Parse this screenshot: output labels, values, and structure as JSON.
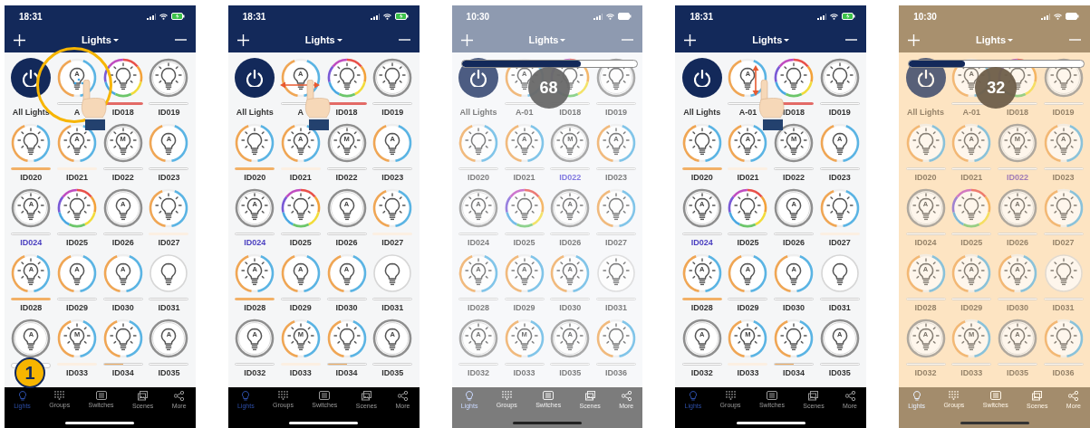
{
  "phones": [
    {
      "kind": "normal",
      "status": {
        "time": "18:31",
        "battery_charging": true
      },
      "header": {
        "title": "Lights"
      },
      "gesture": {
        "kind": "tap",
        "highlight": true,
        "step": "1"
      },
      "tiles": [
        {
          "kind": "power",
          "label": "All Lights",
          "selected": false
        },
        {
          "kind": "warm",
          "label": "A",
          "letter": "A",
          "rays": false,
          "selected": false
        },
        {
          "kind": "rainbow",
          "label": "ID018",
          "rays": true,
          "color": "#e36a66",
          "selected": false
        },
        {
          "kind": "grey",
          "label": "ID019",
          "rays": true,
          "selected": false
        },
        {
          "kind": "warm",
          "label": "ID020",
          "rays": true,
          "color": "#f2b066",
          "selected": false
        },
        {
          "kind": "warm",
          "label": "ID021",
          "letter": "A",
          "rays": true,
          "color": "#fcefe2",
          "selected": false
        },
        {
          "kind": "grey",
          "label": "ID022",
          "letter": "M",
          "rays": true,
          "selected": false
        },
        {
          "kind": "warm",
          "label": "ID023",
          "letter": "A",
          "rays": false,
          "selected": false
        },
        {
          "kind": "grey",
          "label": "ID024",
          "letter": "A",
          "rays": true,
          "selected": true
        },
        {
          "kind": "rainbow",
          "label": "ID025",
          "rays": true,
          "selected": false
        },
        {
          "kind": "grey",
          "label": "ID026",
          "letter": "A",
          "rays": false,
          "selected": false
        },
        {
          "kind": "warm",
          "label": "ID027",
          "rays": true,
          "color": "#fcefe2",
          "selected": false
        },
        {
          "kind": "warm",
          "label": "ID028",
          "letter": "A",
          "rays": true,
          "color": "#f2b066",
          "selected": false
        },
        {
          "kind": "warm",
          "label": "ID029",
          "letter": "A",
          "rays": false,
          "selected": false
        },
        {
          "kind": "warm",
          "label": "ID030",
          "letter": "A",
          "rays": false,
          "selected": false
        },
        {
          "kind": "faint",
          "label": "ID031",
          "rays": false,
          "selected": false
        },
        {
          "kind": "grey",
          "letter": "A",
          "rays": false
        },
        {
          "kind": "warm",
          "label": "ID033",
          "letter": "M",
          "rays": true,
          "color": "#fcefe2",
          "selected": false
        },
        {
          "kind": "warm",
          "label": "ID034",
          "rays": true,
          "color": "#f2b066",
          "level": 0.5,
          "selected": false
        },
        {
          "kind": "grey",
          "label": "ID035",
          "letter": "A",
          "rays": false,
          "selected": false
        }
      ],
      "tabs": [
        {
          "label": "Lights",
          "selected": true
        },
        {
          "label": "Groups",
          "selected": false
        },
        {
          "label": "Switches",
          "selected": false
        },
        {
          "label": "Scenes",
          "selected": false
        },
        {
          "label": "More",
          "selected": false
        }
      ]
    },
    {
      "kind": "normal",
      "status": {
        "time": "18:31",
        "battery_charging": true
      },
      "header": {
        "title": "Lights"
      },
      "gesture": {
        "kind": "swipe-horizontal"
      },
      "tiles": [
        {
          "kind": "power",
          "label": "All Lights",
          "selected": false
        },
        {
          "kind": "warm",
          "label": "A",
          "letter": "A",
          "rays": false,
          "selected": false
        },
        {
          "kind": "rainbow",
          "label": "ID018",
          "rays": true,
          "color": "#e36a66",
          "selected": false
        },
        {
          "kind": "grey",
          "label": "ID019",
          "rays": true,
          "selected": false
        },
        {
          "kind": "warm",
          "label": "ID020",
          "rays": true,
          "color": "#f2b066",
          "selected": false
        },
        {
          "kind": "warm",
          "label": "ID021",
          "letter": "A",
          "rays": true,
          "color": "#fcefe2",
          "selected": false
        },
        {
          "kind": "grey",
          "label": "ID022",
          "letter": "M",
          "rays": true,
          "selected": false
        },
        {
          "kind": "warm",
          "label": "ID023",
          "letter": "A",
          "rays": false,
          "selected": false
        },
        {
          "kind": "grey",
          "label": "ID024",
          "letter": "A",
          "rays": true,
          "selected": true
        },
        {
          "kind": "rainbow",
          "label": "ID025",
          "rays": true,
          "selected": false
        },
        {
          "kind": "grey",
          "label": "ID026",
          "letter": "A",
          "rays": false,
          "selected": false
        },
        {
          "kind": "warm",
          "label": "ID027",
          "rays": true,
          "color": "#fcefe2",
          "selected": false
        },
        {
          "kind": "warm",
          "label": "ID028",
          "letter": "A",
          "rays": true,
          "color": "#f2b066",
          "selected": false
        },
        {
          "kind": "warm",
          "label": "ID029",
          "letter": "A",
          "rays": false,
          "selected": false
        },
        {
          "kind": "warm",
          "label": "ID030",
          "letter": "A",
          "rays": false,
          "selected": false
        },
        {
          "kind": "faint",
          "label": "ID031",
          "rays": false,
          "selected": false
        },
        {
          "kind": "grey",
          "label": "ID032",
          "letter": "A",
          "rays": false,
          "selected": false
        },
        {
          "kind": "warm",
          "label": "ID033",
          "letter": "M",
          "rays": true,
          "color": "#fcefe2",
          "selected": false
        },
        {
          "kind": "warm",
          "label": "ID034",
          "rays": true,
          "color": "#f2b066",
          "level": 0.5,
          "selected": false
        },
        {
          "kind": "grey",
          "label": "ID035",
          "letter": "A",
          "rays": false,
          "selected": false
        }
      ],
      "tabs": [
        {
          "label": "Lights",
          "selected": true
        },
        {
          "label": "Groups",
          "selected": false
        },
        {
          "label": "Switches",
          "selected": false
        },
        {
          "label": "Scenes",
          "selected": false
        },
        {
          "label": "More",
          "selected": false
        }
      ]
    },
    {
      "kind": "dimmed",
      "status": {
        "time": "10:30",
        "battery_charging": false
      },
      "header": {
        "title": "Lights"
      },
      "adjust": {
        "level": 0.68,
        "value": "68"
      },
      "tiles": [
        {
          "kind": "power",
          "label": "All Lights",
          "selected": false
        },
        {
          "kind": "warm",
          "label": "A-01",
          "letter": "A",
          "rays": true,
          "selected": false
        },
        {
          "kind": "rainbow",
          "label": "ID018",
          "rays": true,
          "selected": false
        },
        {
          "kind": "grey",
          "label": "ID019",
          "rays": true,
          "selected": false
        },
        {
          "kind": "warm",
          "label": "ID020",
          "rays": true,
          "selected": false
        },
        {
          "kind": "warm",
          "label": "ID021",
          "letter": "A",
          "rays": true,
          "selected": false
        },
        {
          "kind": "grey",
          "label": "ID022",
          "letter": "M",
          "rays": true,
          "selected": true
        },
        {
          "kind": "warm",
          "label": "ID023",
          "letter": "A",
          "rays": true,
          "selected": false
        },
        {
          "kind": "grey",
          "label": "ID024",
          "letter": "A",
          "rays": true,
          "selected": false
        },
        {
          "kind": "rainbow",
          "label": "ID025",
          "rays": true,
          "selected": false
        },
        {
          "kind": "grey",
          "label": "ID026",
          "letter": "A",
          "rays": true,
          "selected": false
        },
        {
          "kind": "warm",
          "label": "ID027",
          "rays": true,
          "selected": false
        },
        {
          "kind": "warm",
          "label": "ID028",
          "letter": "A",
          "rays": true,
          "selected": false
        },
        {
          "kind": "warm",
          "label": "ID029",
          "letter": "A",
          "rays": true,
          "selected": false
        },
        {
          "kind": "warm",
          "label": "ID030",
          "letter": "A",
          "rays": true,
          "selected": false
        },
        {
          "kind": "faint",
          "label": "ID031",
          "rays": true,
          "selected": false
        },
        {
          "kind": "grey",
          "label": "ID032",
          "letter": "A",
          "rays": true,
          "selected": false
        },
        {
          "kind": "warm",
          "label": "ID033",
          "letter": "M",
          "rays": true,
          "selected": false
        },
        {
          "kind": "grey",
          "label": "ID035",
          "letter": "A",
          "rays": true,
          "selected": false
        },
        {
          "kind": "warm",
          "label": "ID036",
          "rays": true,
          "selected": false
        }
      ],
      "tabs": [
        {
          "label": "Lights",
          "selected": true
        },
        {
          "label": "Groups",
          "selected": false
        },
        {
          "label": "Switches",
          "selected": false
        },
        {
          "label": "Scenes",
          "selected": false
        },
        {
          "label": "More",
          "selected": false
        }
      ]
    },
    {
      "kind": "normal",
      "status": {
        "time": "18:31",
        "battery_charging": true
      },
      "header": {
        "title": "Lights"
      },
      "gesture": {
        "kind": "swipe-vertical"
      },
      "tiles": [
        {
          "kind": "power",
          "label": "All Lights",
          "selected": false
        },
        {
          "kind": "warm",
          "label": "A-01",
          "letter": "A",
          "rays": false,
          "selected": false
        },
        {
          "kind": "rainbow",
          "label": "ID018",
          "rays": true,
          "color": "#e36a66",
          "selected": false
        },
        {
          "kind": "grey",
          "label": "ID019",
          "rays": true,
          "selected": false
        },
        {
          "kind": "warm",
          "label": "ID020",
          "rays": true,
          "color": "#f2b066",
          "selected": false
        },
        {
          "kind": "warm",
          "label": "ID021",
          "letter": "A",
          "rays": true,
          "color": "#fcefe2",
          "selected": false
        },
        {
          "kind": "grey",
          "label": "ID022",
          "letter": "M",
          "rays": true,
          "selected": false
        },
        {
          "kind": "warm",
          "label": "ID023",
          "letter": "A",
          "rays": false,
          "selected": false
        },
        {
          "kind": "grey",
          "label": "ID024",
          "letter": "A",
          "rays": true,
          "selected": true
        },
        {
          "kind": "rainbow",
          "label": "ID025",
          "rays": true,
          "selected": false
        },
        {
          "kind": "grey",
          "label": "ID026",
          "letter": "A",
          "rays": false,
          "selected": false
        },
        {
          "kind": "warm",
          "label": "ID027",
          "rays": true,
          "color": "#fcefe2",
          "selected": false
        },
        {
          "kind": "warm",
          "label": "ID028",
          "letter": "A",
          "rays": true,
          "color": "#f2b066",
          "selected": false
        },
        {
          "kind": "warm",
          "label": "ID029",
          "letter": "A",
          "rays": false,
          "selected": false
        },
        {
          "kind": "warm",
          "label": "ID030",
          "letter": "A",
          "rays": false,
          "selected": false
        },
        {
          "kind": "faint",
          "label": "ID031",
          "rays": false,
          "selected": false
        },
        {
          "kind": "grey",
          "label": "ID032",
          "letter": "A",
          "rays": false,
          "selected": false
        },
        {
          "kind": "warm",
          "label": "ID033",
          "letter": "M",
          "rays": true,
          "color": "#fcefe2",
          "selected": false
        },
        {
          "kind": "warm",
          "label": "ID034",
          "rays": true,
          "color": "#f2b066",
          "level": 0.5,
          "selected": false
        },
        {
          "kind": "grey",
          "label": "ID035",
          "letter": "A",
          "rays": false,
          "selected": false
        }
      ],
      "tabs": [
        {
          "label": "Lights",
          "selected": true
        },
        {
          "label": "Groups",
          "selected": false
        },
        {
          "label": "Switches",
          "selected": false
        },
        {
          "label": "Scenes",
          "selected": false
        },
        {
          "label": "More",
          "selected": false
        }
      ]
    },
    {
      "kind": "warm",
      "status": {
        "time": "10:30",
        "battery_charging": false
      },
      "header": {
        "title": "Lights"
      },
      "adjust": {
        "level": 0.32,
        "value": "32"
      },
      "tiles": [
        {
          "kind": "power",
          "label": "All Lights",
          "selected": false
        },
        {
          "kind": "warm",
          "label": "A-01",
          "letter": "A",
          "rays": true,
          "selected": false
        },
        {
          "kind": "rainbow",
          "label": "ID018",
          "rays": true,
          "selected": false
        },
        {
          "kind": "grey",
          "label": "ID019",
          "rays": true,
          "selected": false
        },
        {
          "kind": "warm",
          "label": "ID020",
          "rays": true,
          "selected": false
        },
        {
          "kind": "warm",
          "label": "ID021",
          "letter": "A",
          "rays": true,
          "selected": false
        },
        {
          "kind": "grey",
          "label": "ID022",
          "letter": "M",
          "rays": true,
          "selected": true
        },
        {
          "kind": "warm",
          "label": "ID023",
          "letter": "A",
          "rays": true,
          "selected": false
        },
        {
          "kind": "grey",
          "label": "ID024",
          "letter": "A",
          "rays": true,
          "selected": false
        },
        {
          "kind": "rainbow",
          "label": "ID025",
          "rays": true,
          "selected": false
        },
        {
          "kind": "grey",
          "label": "ID026",
          "letter": "A",
          "rays": true,
          "selected": false
        },
        {
          "kind": "warm",
          "label": "ID027",
          "rays": true,
          "selected": false
        },
        {
          "kind": "warm",
          "label": "ID028",
          "letter": "A",
          "rays": true,
          "selected": false
        },
        {
          "kind": "warm",
          "label": "ID029",
          "letter": "A",
          "rays": true,
          "selected": false
        },
        {
          "kind": "warm",
          "label": "ID030",
          "letter": "A",
          "rays": true,
          "selected": false
        },
        {
          "kind": "faint",
          "label": "ID031",
          "rays": true,
          "selected": false
        },
        {
          "kind": "grey",
          "label": "ID032",
          "letter": "A",
          "rays": true,
          "selected": false
        },
        {
          "kind": "warm",
          "label": "ID033",
          "letter": "M",
          "rays": true,
          "selected": false
        },
        {
          "kind": "grey",
          "label": "ID035",
          "letter": "A",
          "rays": true,
          "selected": false
        },
        {
          "kind": "warm",
          "label": "ID036",
          "rays": true,
          "selected": false
        }
      ],
      "tabs": [
        {
          "label": "Lights",
          "selected": true
        },
        {
          "label": "Groups",
          "selected": false
        },
        {
          "label": "Switches",
          "selected": false
        },
        {
          "label": "Scenes",
          "selected": false
        },
        {
          "label": "More",
          "selected": false
        }
      ]
    }
  ]
}
